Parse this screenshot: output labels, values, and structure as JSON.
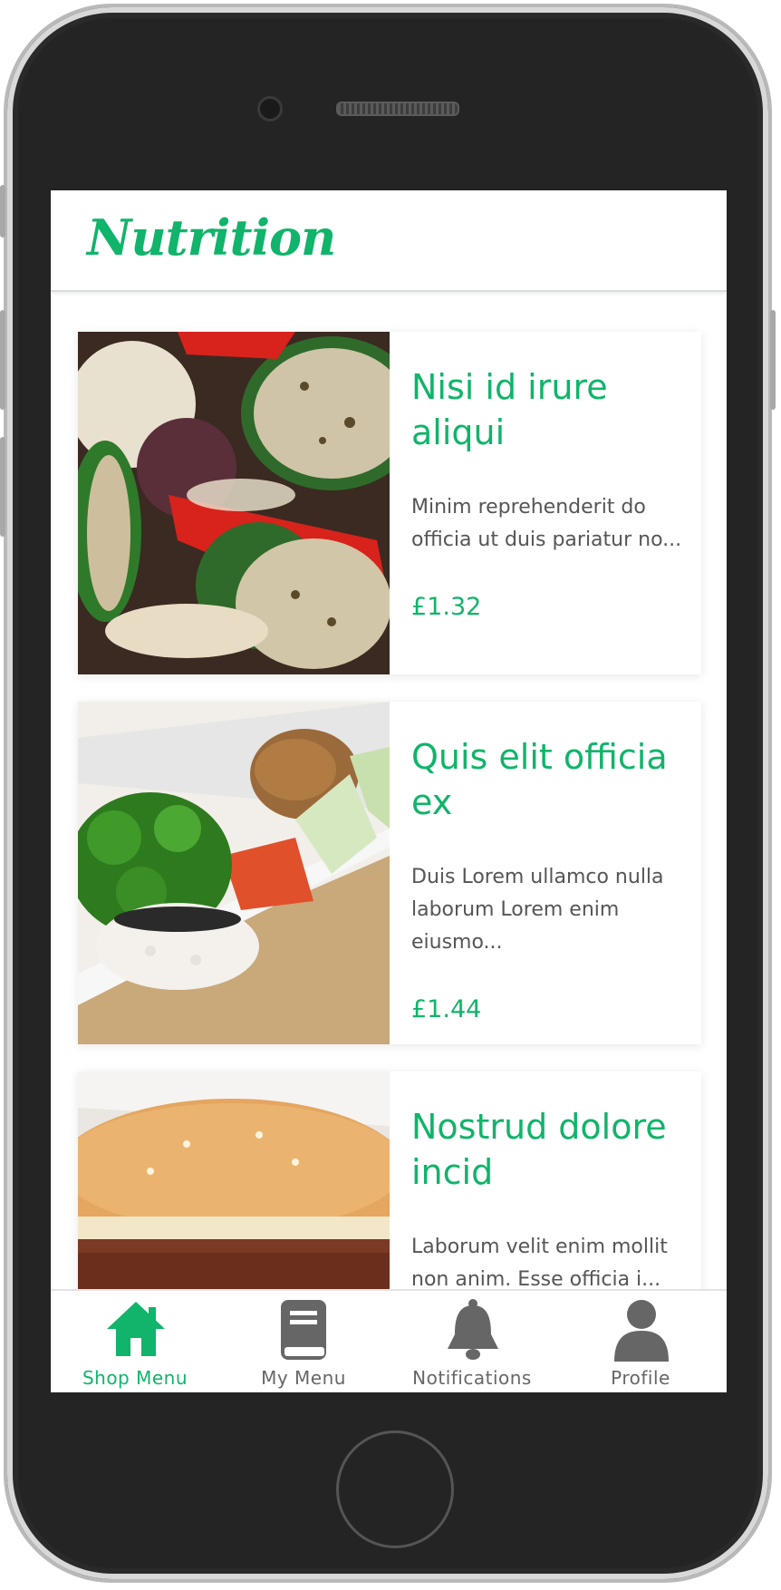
{
  "app": {
    "title": "Nutrition",
    "accent_color": "#10b46a"
  },
  "items": [
    {
      "title": "Nisi id irure aliqui",
      "description": "Minim reprehenderit do officia ut duis pariatur no...",
      "price": "£1.32",
      "image": "grilled-vegetables-photo"
    },
    {
      "title": "Quis elit officia ex",
      "description": "Duis Lorem ullamco nulla laborum Lorem enim eiusmo...",
      "price": "£1.44",
      "image": "sushi-lunchbox-photo"
    },
    {
      "title": "Nostrud dolore incid",
      "description": "Laborum velit enim mollit non anim. Esse officia i...",
      "price": "",
      "image": "burger-photo"
    }
  ],
  "nav": [
    {
      "label": "Shop Menu",
      "icon": "home-icon",
      "active": true
    },
    {
      "label": "My Menu",
      "icon": "book-icon",
      "active": false
    },
    {
      "label": "Notifications",
      "icon": "bell-icon",
      "active": false
    },
    {
      "label": "Profile",
      "icon": "user-icon",
      "active": false
    }
  ]
}
